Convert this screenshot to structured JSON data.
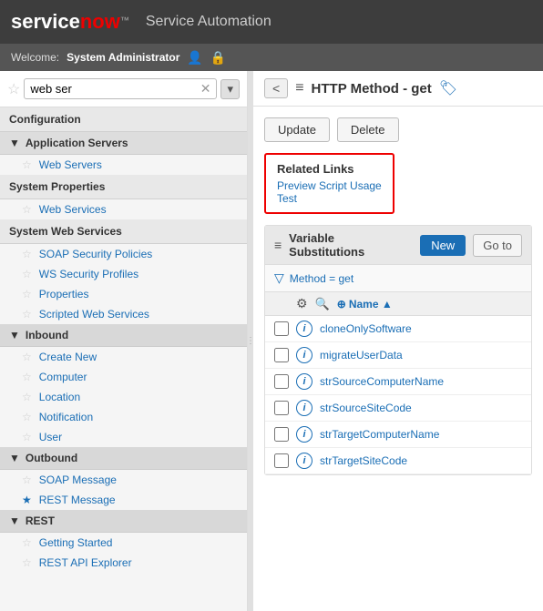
{
  "header": {
    "logo_service": "service",
    "logo_now": "now",
    "logo_tm": "™",
    "title": "Service Automation"
  },
  "subheader": {
    "welcome_label": "Welcome:",
    "username": "System Administrator",
    "user_icon": "👤",
    "lock_icon": "🔒"
  },
  "sidebar": {
    "search_value": "web ser",
    "search_placeholder": "web ser",
    "sections": [
      {
        "id": "configuration",
        "label": "Configuration",
        "type": "section"
      },
      {
        "id": "app-servers",
        "label": "▼ Application Servers",
        "type": "group"
      },
      {
        "id": "web-servers",
        "label": "Web Servers",
        "type": "item",
        "star": false
      },
      {
        "id": "system-properties",
        "label": "System Properties",
        "type": "section"
      },
      {
        "id": "web-services",
        "label": "Web Services",
        "type": "item",
        "star": false
      },
      {
        "id": "system-web-services",
        "label": "System Web Services",
        "type": "section"
      },
      {
        "id": "soap-security",
        "label": "SOAP Security Policies",
        "type": "item",
        "star": false
      },
      {
        "id": "ws-security",
        "label": "WS Security Profiles",
        "type": "item",
        "star": false
      },
      {
        "id": "properties",
        "label": "Properties",
        "type": "item",
        "star": false
      },
      {
        "id": "scripted-ws",
        "label": "Scripted Web Services",
        "type": "item",
        "star": false
      },
      {
        "id": "inbound",
        "label": "▼ Inbound",
        "type": "group"
      },
      {
        "id": "create-new",
        "label": "Create New",
        "type": "item",
        "star": false
      },
      {
        "id": "computer",
        "label": "Computer",
        "type": "item",
        "star": false
      },
      {
        "id": "location",
        "label": "Location",
        "type": "item",
        "star": false
      },
      {
        "id": "notification",
        "label": "Notification",
        "type": "item",
        "star": false
      },
      {
        "id": "user",
        "label": "User",
        "type": "item",
        "star": false
      },
      {
        "id": "outbound",
        "label": "▼ Outbound",
        "type": "group"
      },
      {
        "id": "soap-message",
        "label": "SOAP Message",
        "type": "item",
        "star": false
      },
      {
        "id": "rest-message",
        "label": "REST Message",
        "type": "item",
        "star": true
      },
      {
        "id": "rest",
        "label": "▼ REST",
        "type": "group"
      },
      {
        "id": "getting-started",
        "label": "Getting Started",
        "type": "item",
        "star": false
      },
      {
        "id": "rest-api-explorer",
        "label": "REST API Explorer",
        "type": "item",
        "star": false
      }
    ]
  },
  "panel": {
    "back_label": "<",
    "menu_icon": "≡",
    "title": "HTTP Method - get",
    "tag_icon": "🏷",
    "update_btn": "Update",
    "delete_btn": "Delete",
    "related_links": {
      "title": "Related Links",
      "links": [
        "Preview Script Usage",
        "Test"
      ]
    },
    "var_section": {
      "menu_icon": "≡",
      "title": "Variable Substitutions",
      "new_btn": "New",
      "goto_btn": "Go to",
      "filter_icon": "▽",
      "filter_text": "Method = get",
      "col_name": "Name ▲",
      "rows": [
        {
          "name": "cloneOnlySoftware"
        },
        {
          "name": "migrateUserData"
        },
        {
          "name": "strSourceComputerName"
        },
        {
          "name": "strSourceSiteCode"
        },
        {
          "name": "strTargetComputerName"
        },
        {
          "name": "strTargetSiteCode"
        }
      ]
    }
  }
}
